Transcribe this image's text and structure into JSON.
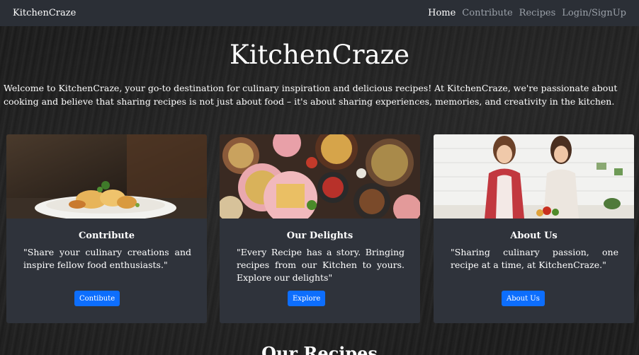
{
  "navbar": {
    "brand": "KitchenCraze",
    "links": [
      "Home",
      "Contribute",
      "Recipes",
      "Login/SignUp"
    ]
  },
  "hero": {
    "title": "KitchenCraze",
    "intro": "Welcome to KitchenCraze, your go-to destination for culinary inspiration and delicious recipes! At KitchenCraze, we're passionate about cooking and believe that sharing recipes is not just about food – it's about sharing experiences, memories, and creativity in the kitchen."
  },
  "cards": [
    {
      "title": "Contribute",
      "text": "\"Share your culinary creations and inspire fellow food enthusiasts.\"",
      "button": "Contibute"
    },
    {
      "title": "Our Delights",
      "text": "\"Every Recipe has a story. Bringing recipes from our Kitchen to yours. Explore our delights\"",
      "button": "Explore"
    },
    {
      "title": "About Us",
      "text": "\"Sharing culinary passion, one recipe at a time, at KitchenCraze.\"",
      "button": "About Us"
    }
  ],
  "section_heading": "Our Recipes",
  "colors": {
    "navbar_bg": "#2b2f36",
    "card_bg": "#2f333b",
    "button_bg": "#0d6efd",
    "nav_inactive": "#9aa0a8"
  }
}
